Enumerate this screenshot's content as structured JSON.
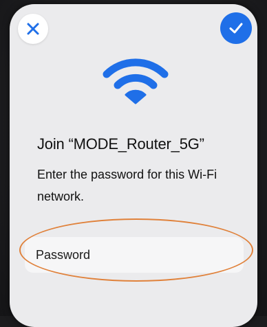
{
  "dialog": {
    "title": "Join “MODE_Router_5G”",
    "subtitle": "Enter the password for this Wi-Fi network.",
    "close_icon": "close-icon",
    "confirm_icon": "checkmark-icon",
    "wifi_icon": "wifi-icon"
  },
  "password": {
    "placeholder": "Password",
    "value": ""
  },
  "colors": {
    "accent": "#1f6fe8",
    "highlight": "#e0813a",
    "card": "#ebebed"
  }
}
